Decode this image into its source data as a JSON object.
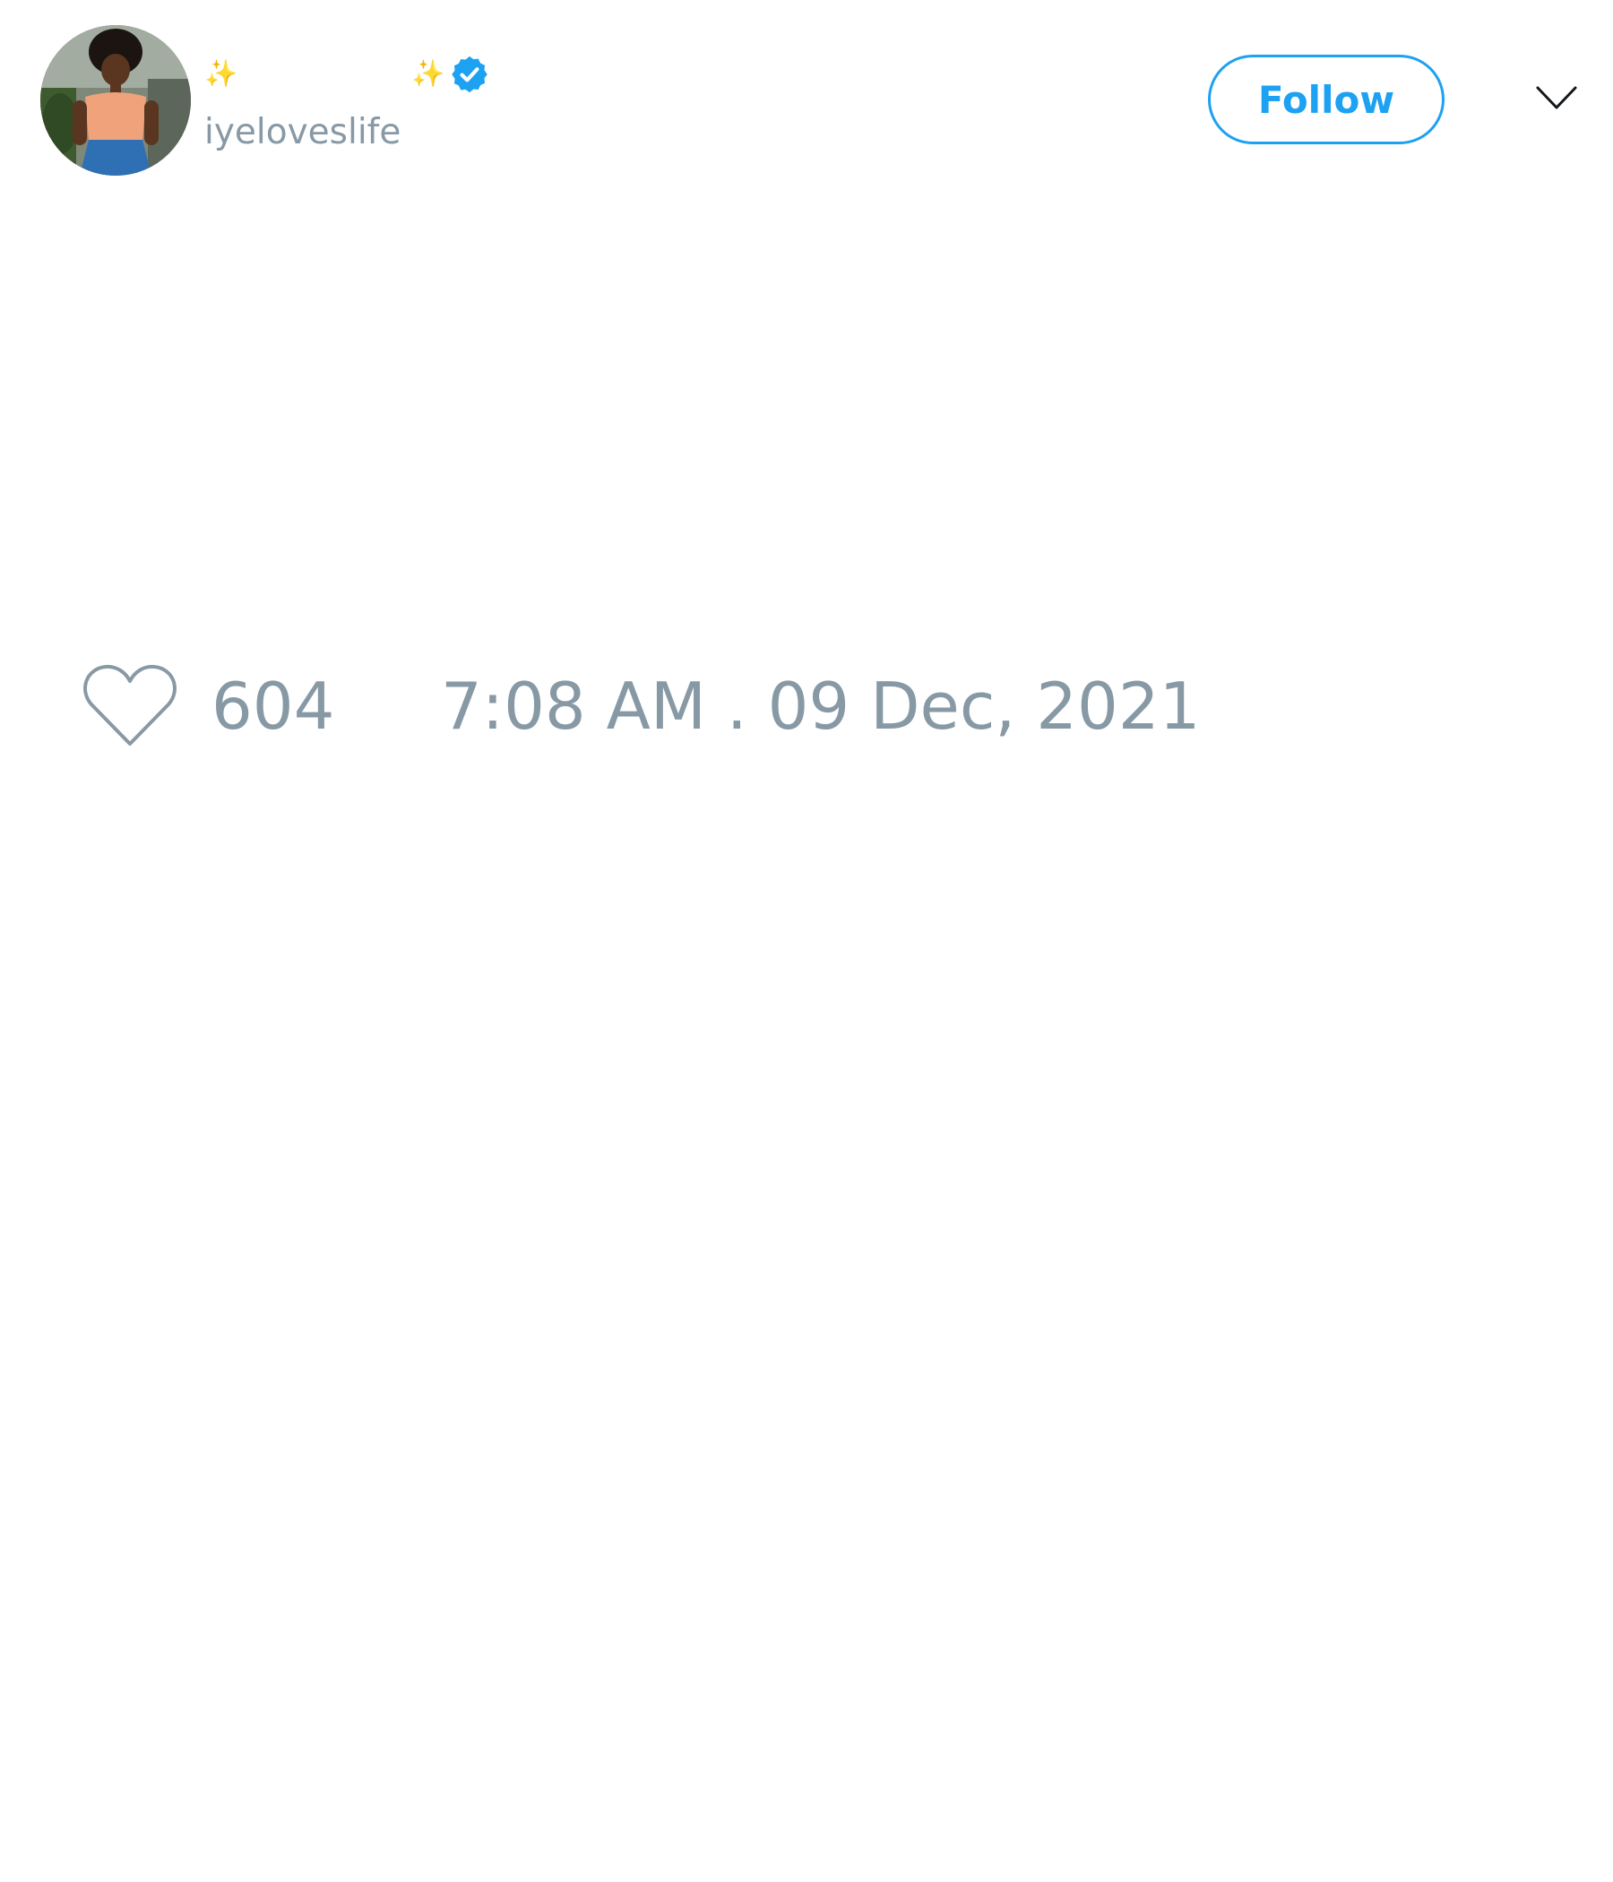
{
  "author": {
    "name_prefix": "✨",
    "name_suffix": "✨",
    "handle": "iyeloveslife",
    "avatar": "profile-photo",
    "verified_icon": "verified-badge-icon"
  },
  "actions": {
    "follow_label": "Follow",
    "menu_icon": "chevron-down-icon"
  },
  "stats": {
    "like_icon": "heart-icon",
    "likes": "604",
    "timestamp": "7:08 AM . 09 Dec, 2021"
  },
  "colors": {
    "accent": "#1da1f2",
    "muted_text": "#8899a6",
    "background": "#ffffff"
  }
}
